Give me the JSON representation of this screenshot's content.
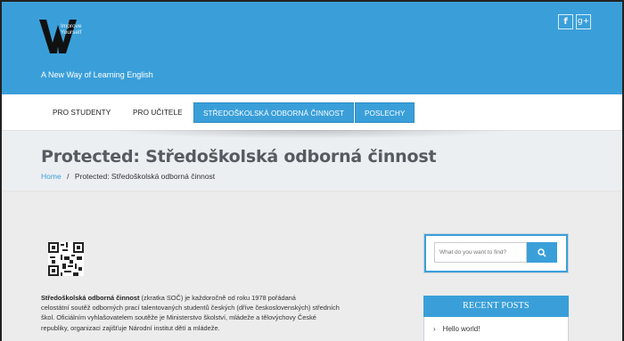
{
  "header": {
    "brand_line1": "Improve",
    "brand_line2": "Yourself",
    "tagline": "A New Way of Learning English",
    "social": [
      {
        "icon": "facebook-icon",
        "glyph": "f"
      },
      {
        "icon": "google-plus-icon",
        "glyph": "g+"
      }
    ],
    "accent_color": "#3a9fd9"
  },
  "nav": {
    "items": [
      {
        "label": "PRO STUDENTY",
        "active": false
      },
      {
        "label": "PRO UČITELE",
        "active": false
      },
      {
        "label": "STŘEDOŠKOLSKÁ ODBORNÁ ČINNOST",
        "active": true
      },
      {
        "label": "POSLECHY",
        "active": true
      }
    ]
  },
  "page": {
    "title": "Protected: Středoškolská odborná činnost",
    "breadcrumb_home": "Home",
    "breadcrumb_sep": "/",
    "breadcrumb_current": "Protected: Středoškolská odborná činnost"
  },
  "article": {
    "bold_term": "Středoškolská odborná činnost",
    "line1_rest": " (zkratka SOČ) je každoročně od roku 1978 pořádaná",
    "line2": "celostátní soutěž odborných prací talentovaných studentů českých (dříve československých) středních",
    "line3": "škol. Oficiálním vyhlašovatelem soutěže je Ministerstvo školství, mládeže a tělovýchovy České",
    "line4": "republiky, organizaci zajišťuje Národní institut dětí a mládeže."
  },
  "sidebar": {
    "search_placeholder": "What do you want to find?",
    "recent_title": "RECENT POSTS",
    "recent_items": [
      "Hello world!"
    ]
  }
}
